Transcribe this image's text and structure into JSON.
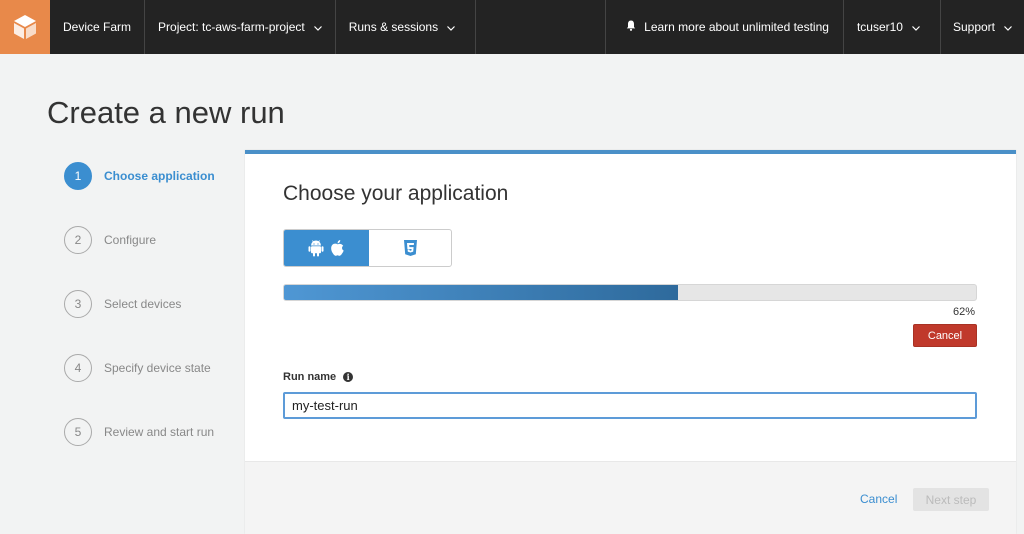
{
  "nav": {
    "brand": "Device Farm",
    "project": "Project: tc-aws-farm-project",
    "runs": "Runs & sessions",
    "learn_more": "Learn more about unlimited testing",
    "user": "tcuser10",
    "support": "Support"
  },
  "page": {
    "title": "Create a new run"
  },
  "steps": [
    {
      "number": "1",
      "label": "Choose application",
      "active": true
    },
    {
      "number": "2",
      "label": "Configure",
      "active": false
    },
    {
      "number": "3",
      "label": "Select devices",
      "active": false
    },
    {
      "number": "4",
      "label": "Specify device state",
      "active": false
    },
    {
      "number": "5",
      "label": "Review and start run",
      "active": false
    }
  ],
  "panel": {
    "title": "Choose your application",
    "app_types": [
      {
        "icons": [
          "android-icon",
          "apple-icon"
        ],
        "selected": true
      },
      {
        "icons": [
          "html5-icon"
        ],
        "selected": false
      }
    ],
    "upload_progress": 0.57,
    "upload_progress_text": "62%",
    "cancel_upload_label": "Cancel",
    "run_name_label": "Run name",
    "run_name_value": "my-test-run"
  },
  "footer": {
    "cancel_label": "Cancel",
    "next_label": "Next step"
  },
  "colors": {
    "accent": "#3b8ed0",
    "danger": "#c0392b",
    "nav_bg": "#232323",
    "logo_bg": "#e8894a"
  }
}
